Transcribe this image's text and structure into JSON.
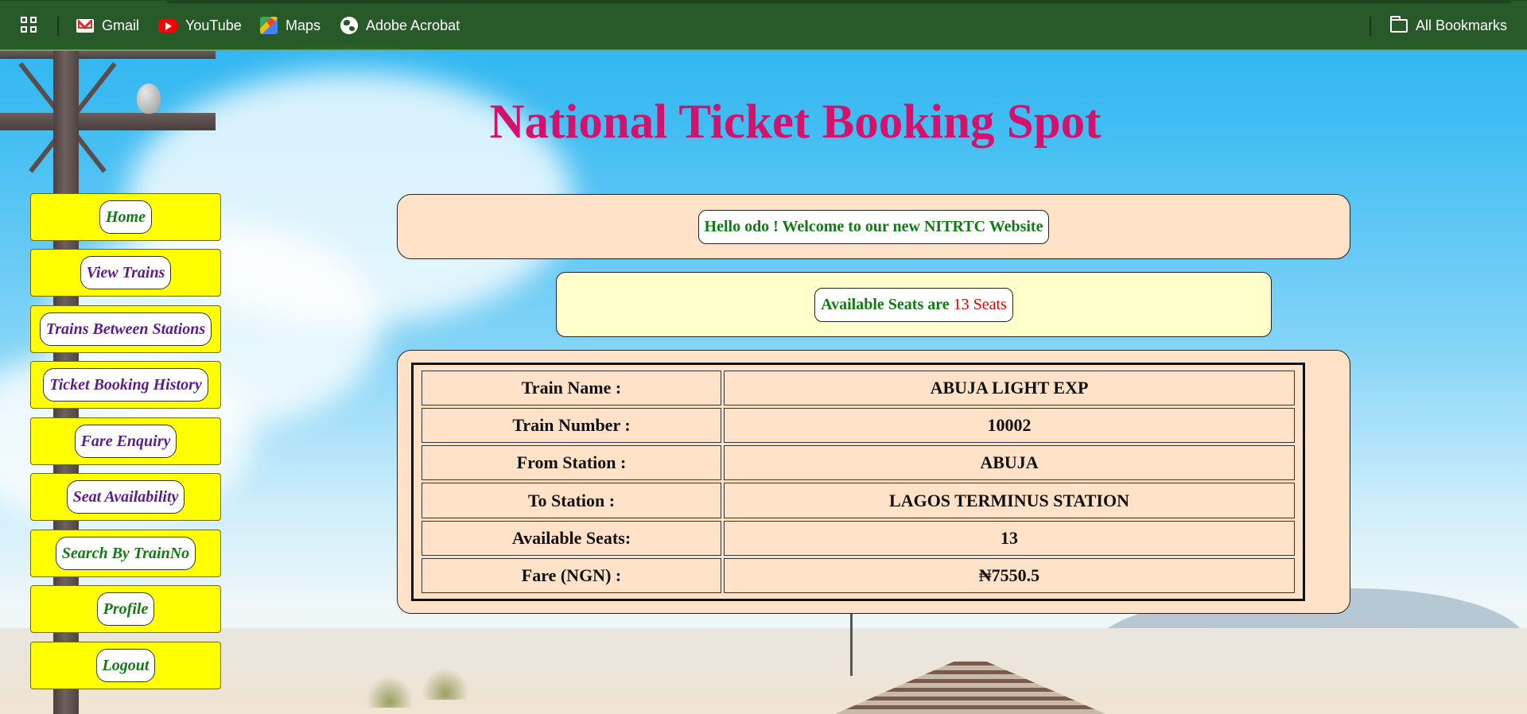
{
  "bookmarks": {
    "items": [
      {
        "label": "Gmail"
      },
      {
        "label": "YouTube"
      },
      {
        "label": "Maps"
      },
      {
        "label": "Adobe Acrobat"
      }
    ],
    "all_bookmarks": "All Bookmarks"
  },
  "page": {
    "title": "National Ticket Booking Spot"
  },
  "sidebar": {
    "items": [
      {
        "label": "Home",
        "color": "#137a13"
      },
      {
        "label": "View Trains",
        "color": "#5b1c8c"
      },
      {
        "label": "Trains Between Stations",
        "color": "#5b1c8c"
      },
      {
        "label": "Ticket Booking History",
        "color": "#5b1c8c"
      },
      {
        "label": "Fare Enquiry",
        "color": "#5b1c8c"
      },
      {
        "label": "Seat Availability",
        "color": "#5b1c8c"
      },
      {
        "label": "Search By TrainNo",
        "color": "#137a13"
      },
      {
        "label": "Profile",
        "color": "#137a13"
      },
      {
        "label": "Logout",
        "color": "#137a13"
      }
    ]
  },
  "welcome": {
    "message": "Hello odo ! Welcome to our new NITRTC Website"
  },
  "availability": {
    "label": "Available Seats are",
    "seats": "13 Seats"
  },
  "details": {
    "rows": [
      {
        "key": "Train Name :",
        "value": "ABUJA LIGHT EXP"
      },
      {
        "key": "Train Number :",
        "value": "10002"
      },
      {
        "key": "From Station :",
        "value": "ABUJA"
      },
      {
        "key": "To Station :",
        "value": "LAGOS TERMINUS STATION"
      },
      {
        "key": "Available Seats:",
        "value": "13"
      },
      {
        "key": "Fare (NGN) :",
        "value": "₦7550.5"
      }
    ]
  },
  "colors": {
    "bookmarks_bar": "#275a28",
    "title": "#d4116c",
    "nav_background": "#ffff00",
    "panel_peach": "#ffe2c8",
    "panel_cream": "#ffffcc",
    "welcome_text": "#137a13",
    "seats_highlight": "#e00000"
  }
}
